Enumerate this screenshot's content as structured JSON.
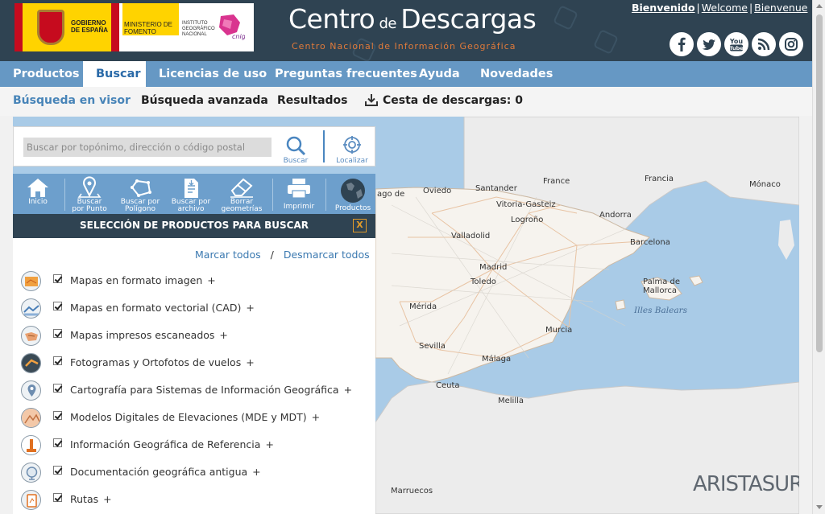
{
  "header": {
    "gov_label": "GOBIERNO DE ESPAÑA",
    "ministry_label": "MINISTERIO DE FOMENTO",
    "institute_label": "INSTITUTO GEOGRÁFICO NACIONAL",
    "cnig_label": "cnig",
    "title_main_1": "Centro",
    "title_de": " de ",
    "title_main_2": "Descargas",
    "subtitle": "Centro Nacional de Información Geográfica",
    "lang": [
      "Bienvenido",
      "Welcome",
      "Bienvenue"
    ],
    "social": [
      "facebook-icon",
      "twitter-icon",
      "youtube-icon",
      "rss-icon",
      "instagram-icon"
    ],
    "youtube_label": "You Tube"
  },
  "nav": {
    "items": [
      "Productos",
      "Buscar",
      "Licencias de uso",
      "Preguntas frecuentes",
      "Ayuda",
      "Novedades"
    ],
    "active_index": 1
  },
  "subnav": {
    "items": [
      "Búsqueda en visor",
      "Búsqueda avanzada",
      "Resultados"
    ],
    "basket_label": "Cesta de descargas: 0"
  },
  "search": {
    "placeholder": "Buscar por topónimo, dirección o código postal",
    "search_label": "Buscar",
    "locate_label": "Localizar"
  },
  "toolbar": {
    "home": "Inicio",
    "by_point_1": "Buscar",
    "by_point_2": "por Punto",
    "by_polygon_1": "Buscar por",
    "by_polygon_2": "Polígono",
    "by_file_1": "Buscar por",
    "by_file_2": "archivo",
    "erase_1": "Borrar",
    "erase_2": "geometrías",
    "print": "Imprimir",
    "products": "Productos"
  },
  "panel": {
    "title": "SELECCIÓN DE PRODUCTOS PARA BUSCAR",
    "close": "X",
    "mark_all": "Marcar todos",
    "slash": "/",
    "unmark_all": "Desmarcar todos",
    "products": [
      "Mapas en formato imagen",
      "Mapas en formato vectorial (CAD)",
      "Mapas impresos escaneados",
      "Fotogramas y Ortofotos de vuelos",
      "Cartografía para Sistemas de Información Geográfica",
      "Modelos Digitales de Elevaciones (MDE y MDT)",
      "Información Geográfica de Referencia",
      "Documentación geográfica antigua",
      "Rutas"
    ],
    "plus": "+"
  },
  "map": {
    "labels": {
      "francia1": "France",
      "francia2": "Francia",
      "monaco": "Mónaco",
      "andorra": "Andorra",
      "barcelona": "Barcelona",
      "oviedo": "Oviedo",
      "santander": "Santander",
      "vitoria": "Vitoria-Gasteiz",
      "logrono": "Logroño",
      "santiago": "ago de",
      "valladolid": "Valladolid",
      "madrid": "Madrid",
      "toledo": "Toledo",
      "merida": "Mérida",
      "palma": "Palma de",
      "mallorca": "Mallorca",
      "baleares": "Illes Balears",
      "murcia": "Murcia",
      "sevilla": "Sevilla",
      "malaga": "Málaga",
      "ceuta": "Ceuta",
      "melilla": "Melilla",
      "marruecos": "Marruecos"
    },
    "brand": "ARISTASUR"
  }
}
